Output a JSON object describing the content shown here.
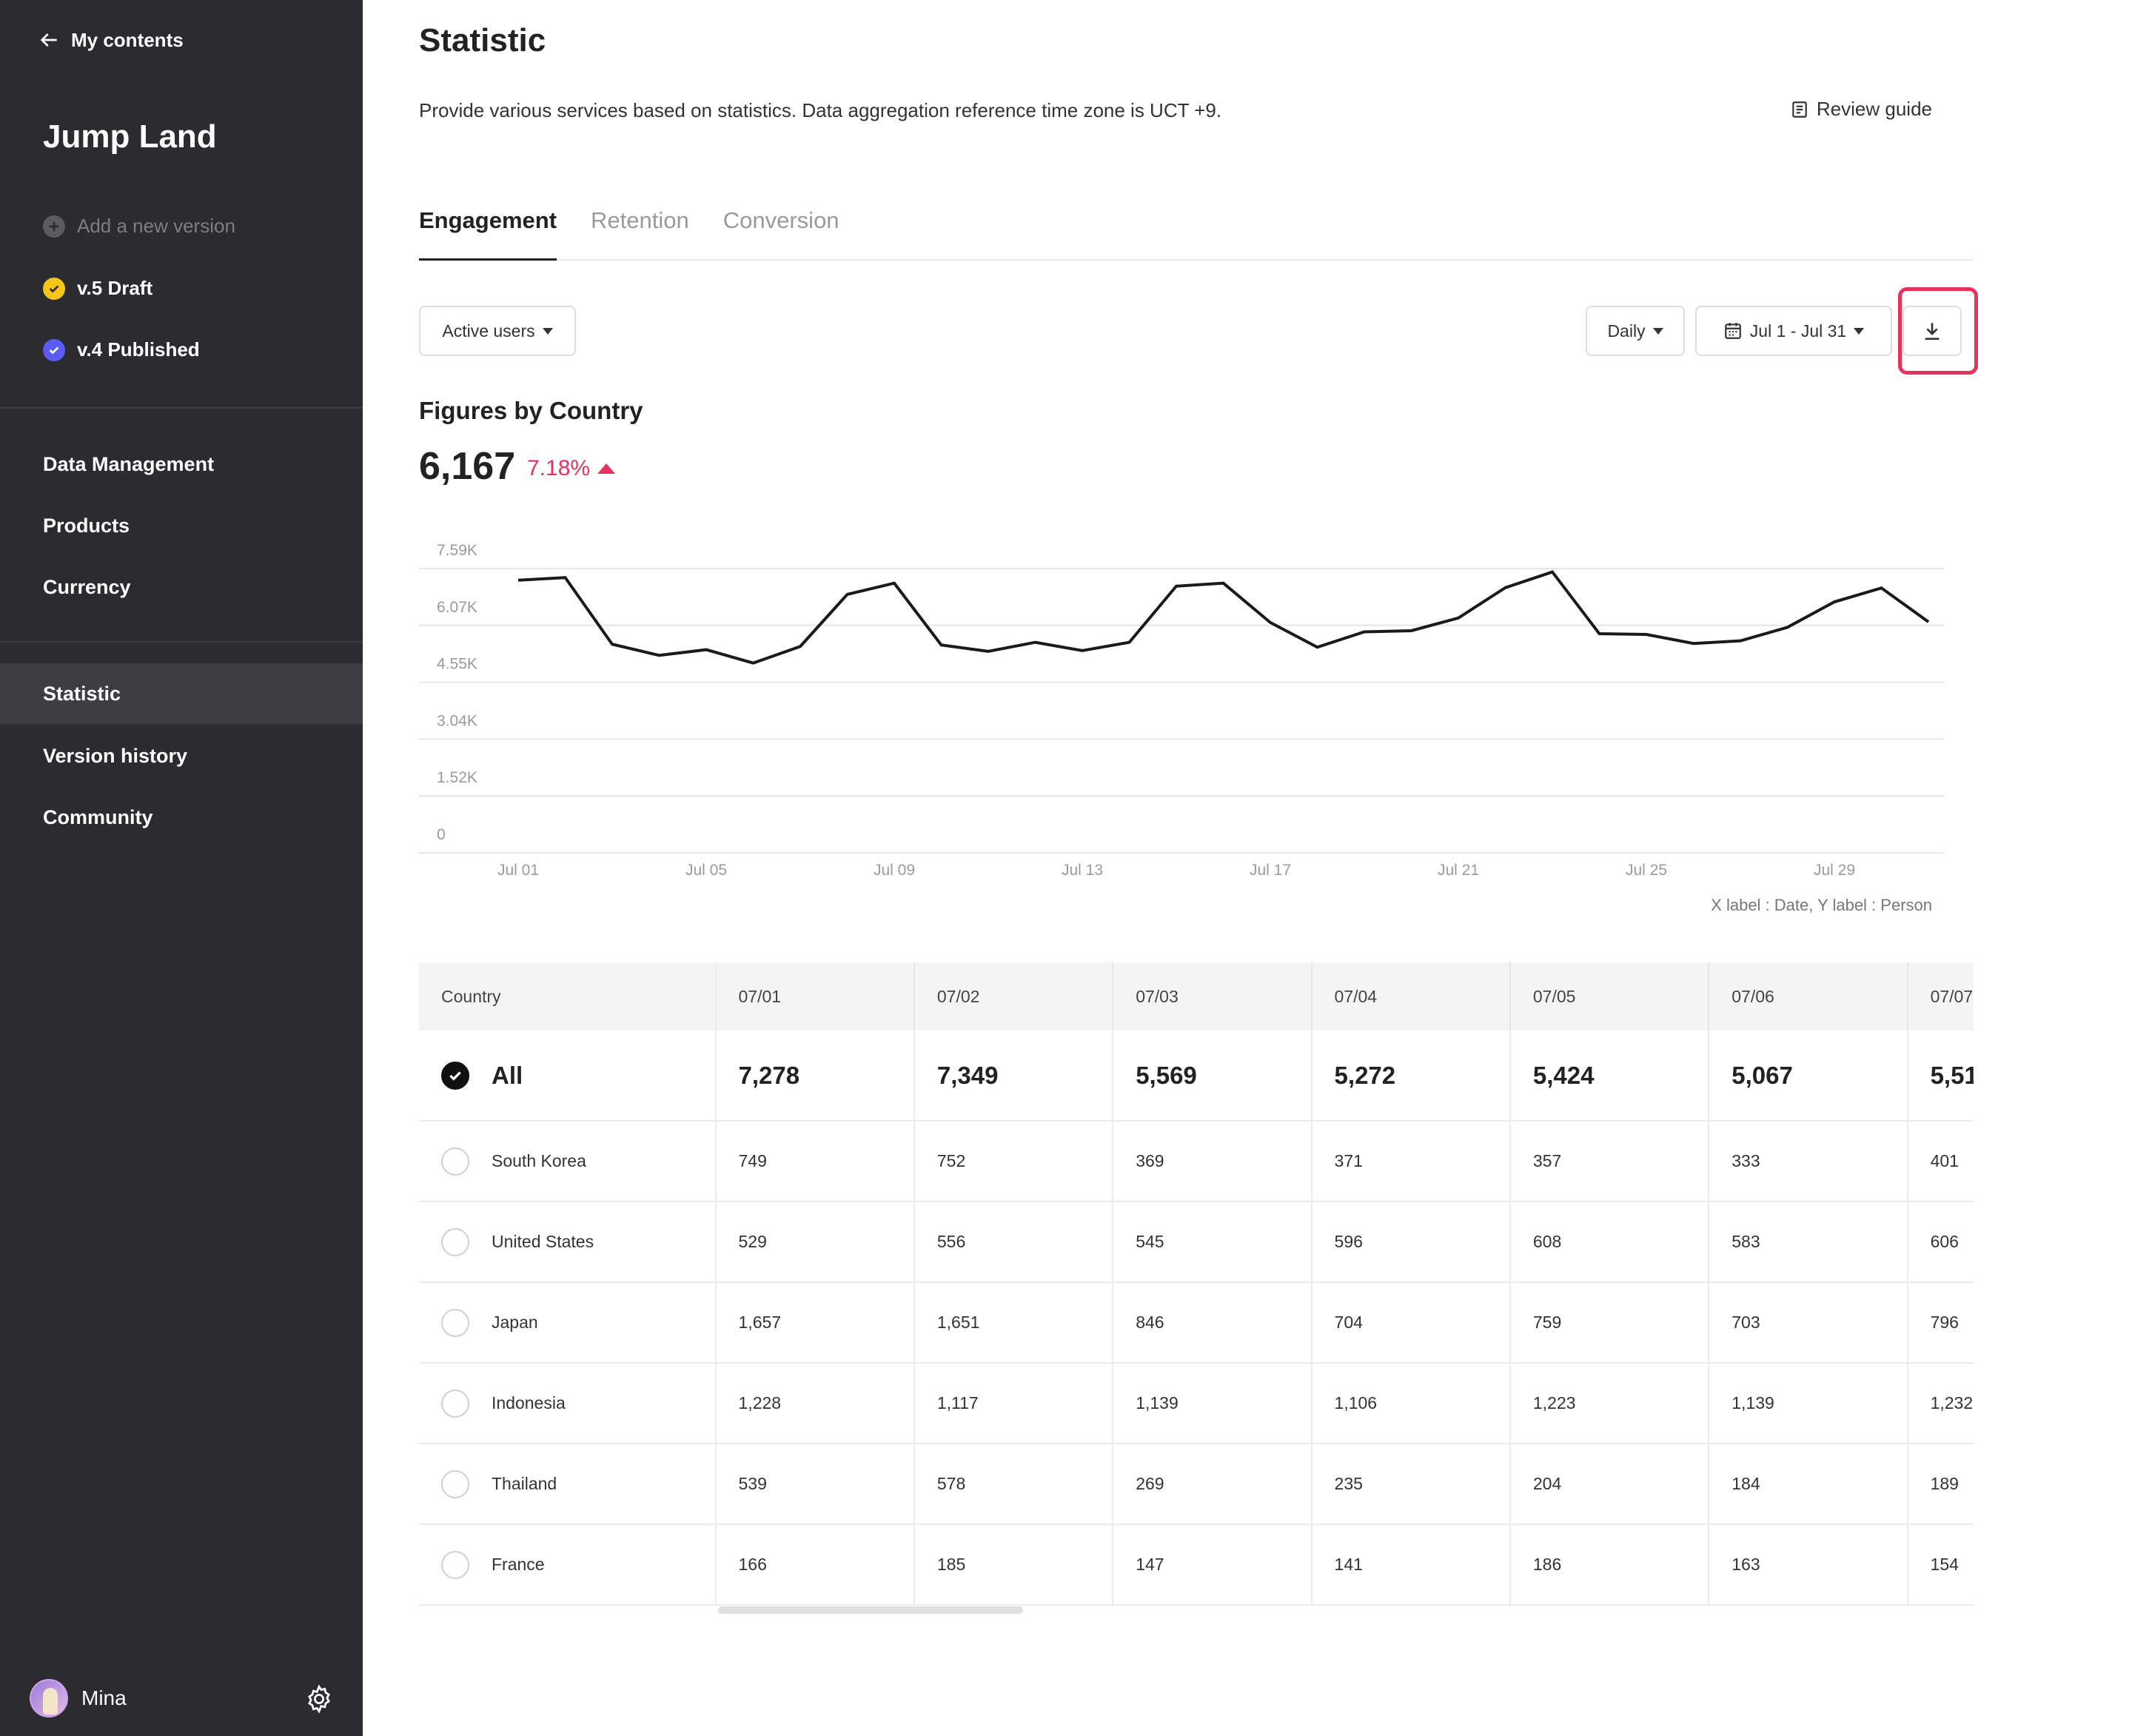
{
  "sidebar": {
    "back_label": "My contents",
    "app_title": "Jump Land",
    "versions": {
      "add_label": "Add a new version",
      "draft_label": "v.5 Draft",
      "published_label": "v.4 Published"
    },
    "nav": [
      {
        "label": "Data Management"
      },
      {
        "label": "Products"
      },
      {
        "label": "Currency"
      },
      {
        "label": "Statistic",
        "active": true
      },
      {
        "label": "Version history"
      },
      {
        "label": "Community"
      }
    ],
    "user": {
      "name": "Mina"
    },
    "colors": {
      "draft": "#f5c518",
      "published": "#5b5bf5"
    }
  },
  "header": {
    "title": "Statistic",
    "description": "Provide various services based on statistics. Data aggregation reference time zone is UCT +9.",
    "review_guide": "Review guide"
  },
  "tabs": [
    {
      "label": "Engagement",
      "active": true
    },
    {
      "label": "Retention"
    },
    {
      "label": "Conversion"
    }
  ],
  "controls": {
    "metric": "Active users",
    "period": "Daily",
    "date_range": "Jul 1 - Jul 31"
  },
  "summary": {
    "title": "Figures by Country",
    "value": "6,167",
    "delta": "7.18%",
    "delta_color": "#e8315b"
  },
  "chart_data": {
    "type": "line",
    "x": [
      "Jul 01",
      "Jul 02",
      "Jul 03",
      "Jul 04",
      "Jul 05",
      "Jul 06",
      "Jul 07",
      "Jul 08",
      "Jul 09",
      "Jul 10",
      "Jul 11",
      "Jul 12",
      "Jul 13",
      "Jul 14",
      "Jul 15",
      "Jul 16",
      "Jul 17",
      "Jul 18",
      "Jul 19",
      "Jul 20",
      "Jul 21",
      "Jul 22",
      "Jul 23",
      "Jul 24",
      "Jul 25",
      "Jul 26",
      "Jul 27",
      "Jul 28",
      "Jul 29",
      "Jul 30",
      "Jul 31"
    ],
    "x_tick_labels": [
      "Jul 01",
      "Jul 05",
      "Jul 09",
      "Jul 13",
      "Jul 17",
      "Jul 21",
      "Jul 25",
      "Jul 29"
    ],
    "series": [
      {
        "values": [
          7278,
          7349,
          5569,
          5272,
          5424,
          5067,
          5510,
          6900,
          7200,
          5550,
          5380,
          5620,
          5400,
          5620,
          7120,
          7200,
          6150,
          5490,
          5900,
          5930,
          6270,
          7080,
          7500,
          5850,
          5830,
          5590,
          5660,
          6020,
          6700,
          7070,
          6167
        ]
      }
    ],
    "y_tick_labels": [
      "0",
      "1.52K",
      "3.04K",
      "4.55K",
      "6.07K",
      "7.59K"
    ],
    "ylim": [
      0,
      7590
    ],
    "grid": true,
    "line_color": "#1a1a1a",
    "axis_note": "X label : Date, Y label : Person"
  },
  "table": {
    "headers": [
      "Country",
      "07/01",
      "07/02",
      "07/03",
      "07/04",
      "07/05",
      "07/06",
      "07/07"
    ],
    "rows": [
      {
        "country": "All",
        "checked": true,
        "values": [
          "7,278",
          "7,349",
          "5,569",
          "5,272",
          "5,424",
          "5,067",
          "5,51"
        ]
      },
      {
        "country": "South Korea",
        "values": [
          "749",
          "752",
          "369",
          "371",
          "357",
          "333",
          "401"
        ]
      },
      {
        "country": "United States",
        "values": [
          "529",
          "556",
          "545",
          "596",
          "608",
          "583",
          "606"
        ]
      },
      {
        "country": "Japan",
        "values": [
          "1,657",
          "1,651",
          "846",
          "704",
          "759",
          "703",
          "796"
        ]
      },
      {
        "country": "Indonesia",
        "values": [
          "1,228",
          "1,117",
          "1,139",
          "1,106",
          "1,223",
          "1,139",
          "1,232"
        ]
      },
      {
        "country": "Thailand",
        "values": [
          "539",
          "578",
          "269",
          "235",
          "204",
          "184",
          "189"
        ]
      },
      {
        "country": "France",
        "values": [
          "166",
          "185",
          "147",
          "141",
          "186",
          "163",
          "154"
        ]
      }
    ]
  }
}
